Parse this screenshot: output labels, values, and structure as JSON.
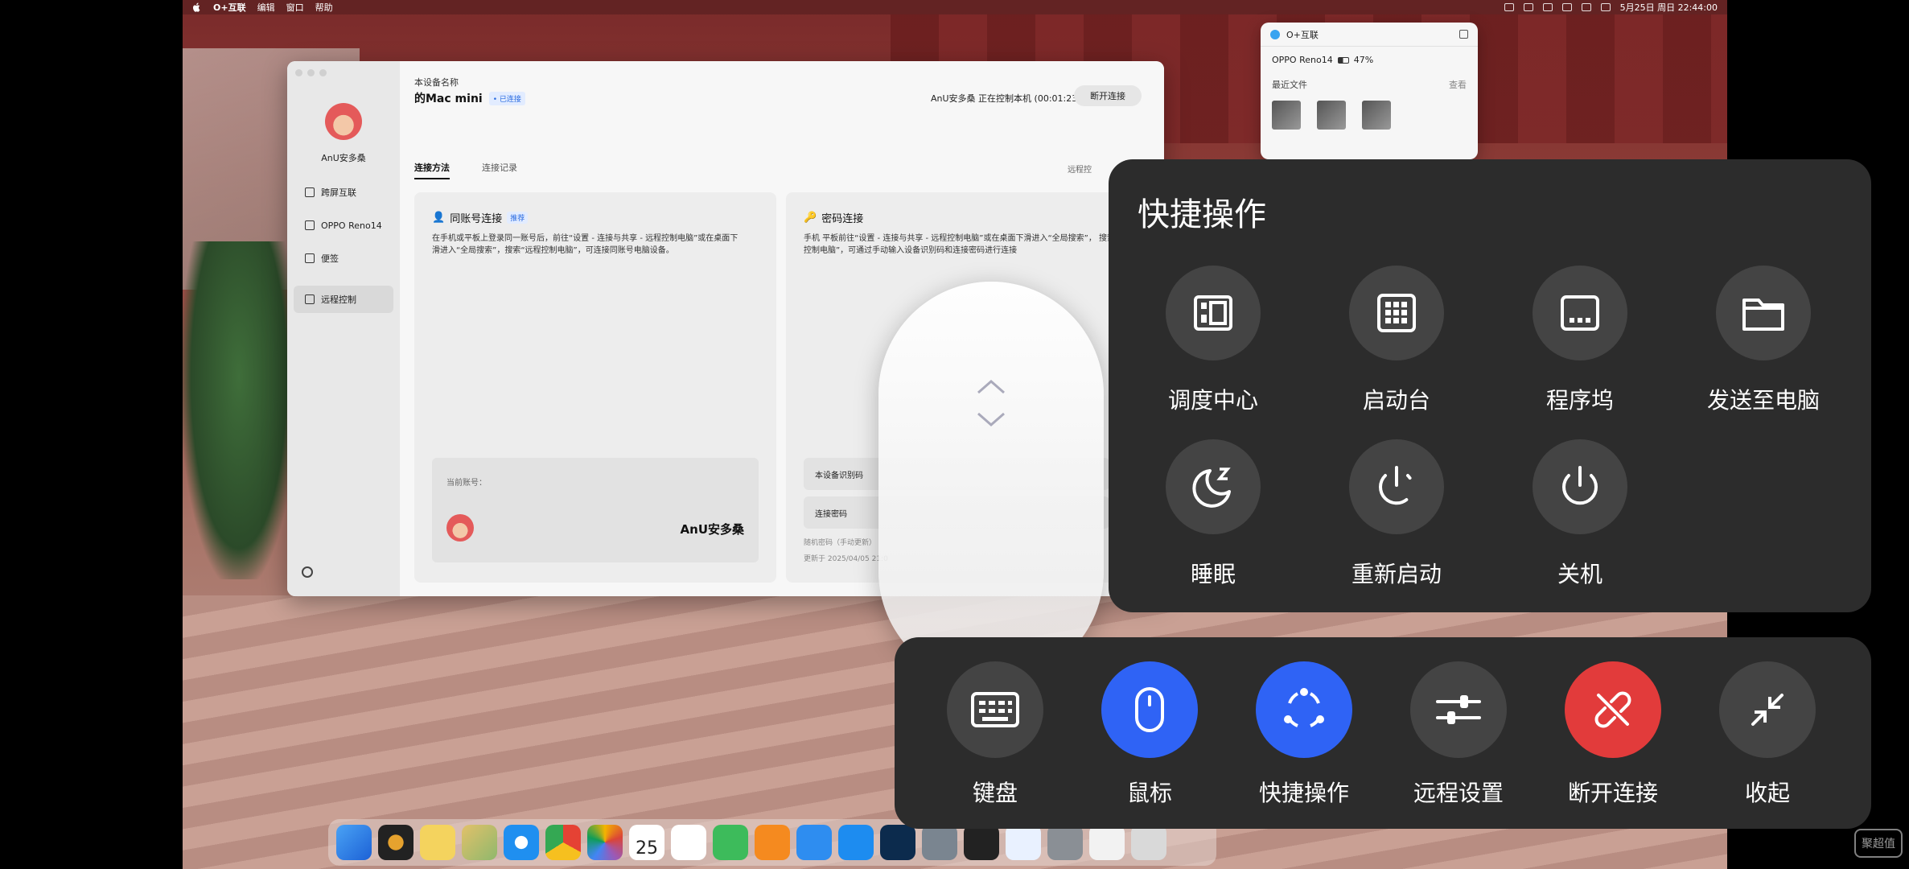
{
  "menubar": {
    "app_name": "O+互联",
    "items": [
      "编辑",
      "窗口",
      "帮助"
    ],
    "clock": "5月25日 周日 22:44:00"
  },
  "app": {
    "user": "AnU安多桑",
    "sidebar": [
      {
        "label": "跨屏互联",
        "icon": "screen-icon"
      },
      {
        "label": "OPPO Reno14",
        "icon": "phone-icon"
      },
      {
        "label": "便签",
        "icon": "note-icon"
      },
      {
        "label": "远程控制",
        "icon": "remote-icon"
      }
    ],
    "device_label": "本设备名称",
    "device_name": "的Mac mini",
    "device_badge": "• 已连接",
    "status": "AnU安多桑 正在控制本机 (00:01:23)",
    "disconnect": "断开连接",
    "tabs": [
      "连接方法",
      "连接记录"
    ],
    "remote_hint": "远程控",
    "card1": {
      "title": "同账号连接",
      "tag": "推荐",
      "desc": "在手机或平板上登录同一账号后，前往“设置 - 连接与共享 - 远程控制电脑”或在桌面下滑进入“全局搜索”，搜索“远程控制电脑”，可连接同账号电脑设备。",
      "current_label": "当前账号：",
      "account": "AnU安多桑"
    },
    "card2": {
      "title": "密码连接",
      "desc": "手机 平板前往“设置 - 连接与共享 - 远程控制电脑”或在桌面下滑进入“全局搜索”， 搜索 控制电脑”，可通过手动输入设备识别码和连接密码进行连接",
      "row1": "本设备识别码",
      "row2": "连接密码",
      "random": "随机密码（手动更新）",
      "updated": "更新于 2025/04/05 21:0"
    }
  },
  "mini": {
    "title": "O+互联",
    "device": "OPPO Reno14",
    "battery": "47%",
    "recent": "最近文件",
    "more": "查看"
  },
  "dock_day": "25",
  "quick": {
    "title": "快捷操作",
    "items": [
      {
        "label": "调度中心",
        "icon": "mission-control-icon"
      },
      {
        "label": "启动台",
        "icon": "launchpad-icon"
      },
      {
        "label": "程序坞",
        "icon": "dock-icon"
      },
      {
        "label": "发送至电脑",
        "icon": "folder-icon"
      },
      {
        "label": "睡眠",
        "icon": "sleep-icon"
      },
      {
        "label": "重新启动",
        "icon": "restart-icon"
      },
      {
        "label": "关机",
        "icon": "power-icon"
      }
    ]
  },
  "toolbar": {
    "items": [
      {
        "label": "键盘",
        "icon": "keyboard-icon",
        "color": "#444444"
      },
      {
        "label": "鼠标",
        "icon": "mouse-icon",
        "color": "#2f63f5"
      },
      {
        "label": "快捷操作",
        "icon": "quick-actions-icon",
        "color": "#2f63f5"
      },
      {
        "label": "远程设置",
        "icon": "sliders-icon",
        "color": "#444444"
      },
      {
        "label": "断开连接",
        "icon": "unlink-icon",
        "color": "#e23b3b"
      },
      {
        "label": "收起",
        "icon": "collapse-icon",
        "color": "#444444"
      }
    ]
  },
  "watermark": "聚超值"
}
